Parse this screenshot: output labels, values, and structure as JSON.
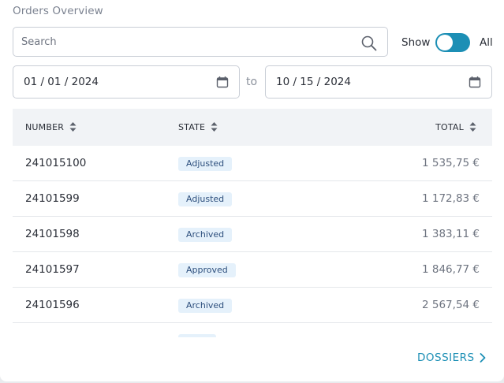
{
  "header": {
    "title": "Orders Overview"
  },
  "search": {
    "placeholder": "Search"
  },
  "toggle": {
    "left_label": "Show",
    "right_label": "All",
    "state": "on",
    "color": "#1c8fb5"
  },
  "date_range": {
    "from": "01 / 01 / 2024",
    "separator": "to",
    "to": "10 / 15 / 2024"
  },
  "table": {
    "columns": [
      {
        "label": "NUMBER"
      },
      {
        "label": "STATE"
      },
      {
        "label": "TOTAL"
      }
    ],
    "rows": [
      {
        "number": "241015100",
        "state": "Adjusted",
        "total": "1 535,75 €"
      },
      {
        "number": "24101599",
        "state": "Adjusted",
        "total": "1 172,83 €"
      },
      {
        "number": "24101598",
        "state": "Archived",
        "total": "1 383,11 €"
      },
      {
        "number": "24101597",
        "state": "Approved",
        "total": "1 846,77 €"
      },
      {
        "number": "24101596",
        "state": "Archived",
        "total": "2 567,54 €"
      },
      {
        "number": "",
        "state": "",
        "total": ""
      }
    ]
  },
  "footer": {
    "link_label": "DOSSIERS"
  },
  "icons": {
    "search": "search-icon",
    "calendar": "calendar-icon",
    "sort": "sort-icon",
    "chevron": "chevron-right-icon"
  }
}
